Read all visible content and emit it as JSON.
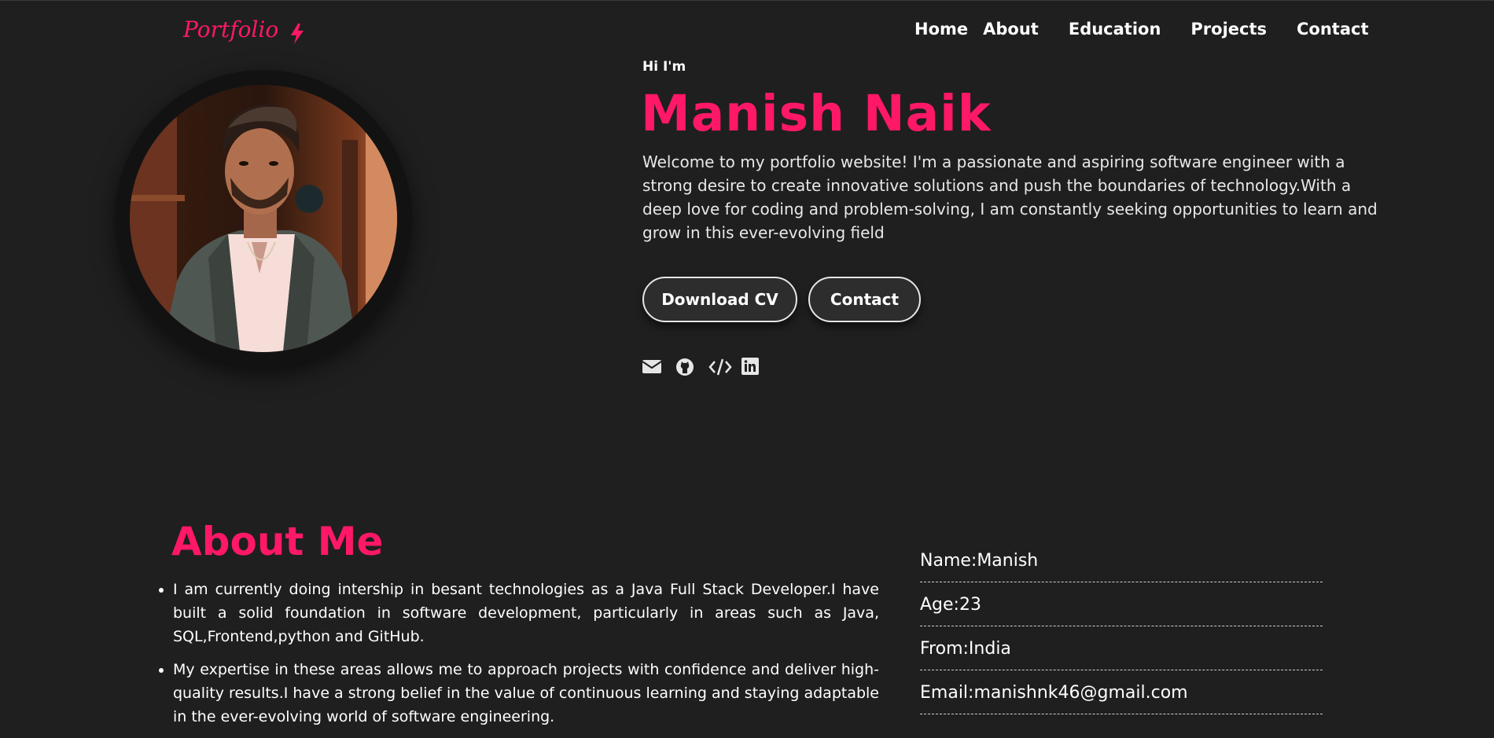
{
  "logo": {
    "text": "Portfolio",
    "accent_color": "#ff1867",
    "icon": "lightning-bolt-icon"
  },
  "nav": {
    "home": "Home",
    "about": "About",
    "education": "Education",
    "projects": "Projects",
    "contact": "Contact"
  },
  "hero": {
    "greeting": "Hi I'm",
    "name": "Manish Naik",
    "intro": "Welcome to my portfolio website! I'm a passionate and aspiring software engineer with a strong desire to create innovative solutions and push the boundaries of technology.With a deep love for coding and problem-solving, I am constantly seeking opportunities to learn and grow in this ever-evolving field",
    "buttons": {
      "download_cv": "Download CV",
      "contact": "Contact"
    },
    "socials": [
      "envelope-icon",
      "github-icon",
      "code-icon",
      "linkedin-icon"
    ]
  },
  "about": {
    "title": "About Me",
    "points": [
      "I am currently doing intership in besant technologies as a Java Full Stack Developer.I have built a solid foundation in software development, particularly in areas such as Java, SQL,Frontend,python and GitHub.",
      "My expertise in these areas allows me to approach projects with confidence and deliver high-quality results.I have a strong belief in the value of continuous learning and staying adaptable in the ever-evolving world of software engineering."
    ],
    "info": [
      "Name:Manish",
      "Age:23",
      "From:India",
      "Email:manishnk46@gmail.com"
    ]
  },
  "colors": {
    "background": "#1f1f1f",
    "accent": "#ff1867",
    "text": "#ffffff"
  }
}
